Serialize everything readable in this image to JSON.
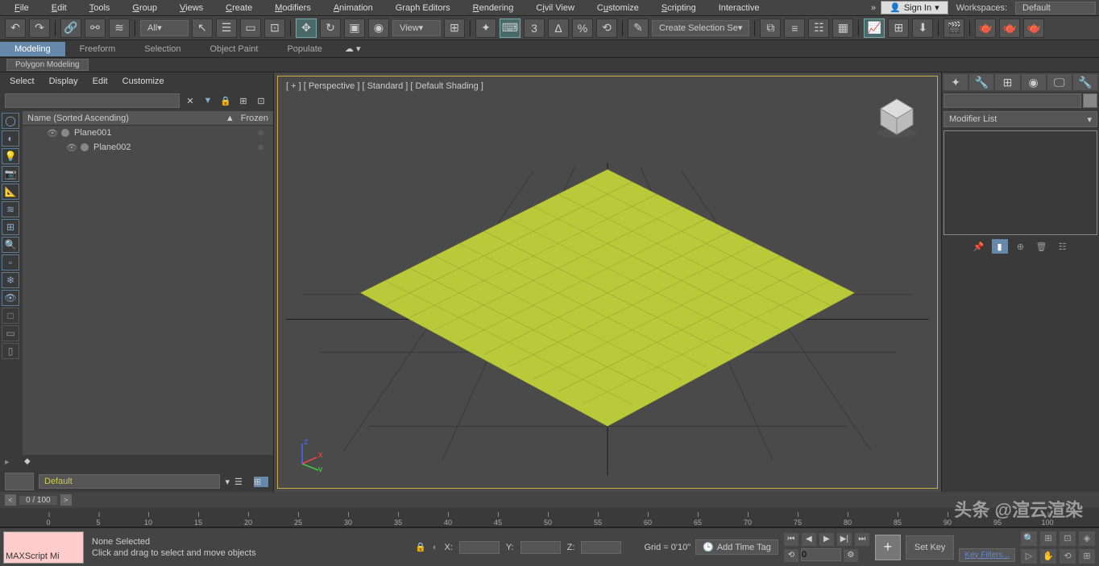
{
  "menubar": {
    "items": [
      "File",
      "Edit",
      "Tools",
      "Group",
      "Views",
      "Create",
      "Modifiers",
      "Animation",
      "Graph Editors",
      "Rendering",
      "Civil View",
      "Customize",
      "Scripting",
      "Interactive"
    ],
    "signin": "Sign In",
    "workspaces_label": "Workspaces:",
    "workspaces_value": "Default"
  },
  "toolbar": {
    "filter_all": "All",
    "view": "View",
    "create_sel": "Create Selection Se"
  },
  "ribbon": {
    "tabs": [
      "Modeling",
      "Freeform",
      "Selection",
      "Object Paint",
      "Populate"
    ],
    "sub": "Polygon Modeling"
  },
  "scene": {
    "menus": [
      "Select",
      "Display",
      "Edit",
      "Customize"
    ],
    "header_name": "Name (Sorted Ascending)",
    "header_frozen": "Frozen",
    "items": [
      {
        "name": "Plane001"
      },
      {
        "name": "Plane002"
      }
    ],
    "layer": "Default"
  },
  "viewport": {
    "label": "[ + ] [ Perspective ] [ Standard ] [ Default Shading ]"
  },
  "cmdpanel": {
    "modifier_list": "Modifier List"
  },
  "timeline": {
    "slider": "0 / 100",
    "ticks": [
      0,
      5,
      10,
      15,
      20,
      25,
      30,
      35,
      40,
      45,
      50,
      55,
      60,
      65,
      70,
      75,
      80,
      85,
      90,
      95,
      100
    ]
  },
  "status": {
    "maxscript": "MAXScript Mi",
    "selection": "None Selected",
    "prompt": "Click and drag to select and move objects",
    "x": "X:",
    "y": "Y:",
    "z": "Z:",
    "grid": "Grid = 0'10\"",
    "addtime": "Add Time Tag",
    "frame": "0",
    "setkey": "Set Key",
    "keyfilters": "Key Filters..."
  },
  "watermark": "头条 @渲云渲染"
}
